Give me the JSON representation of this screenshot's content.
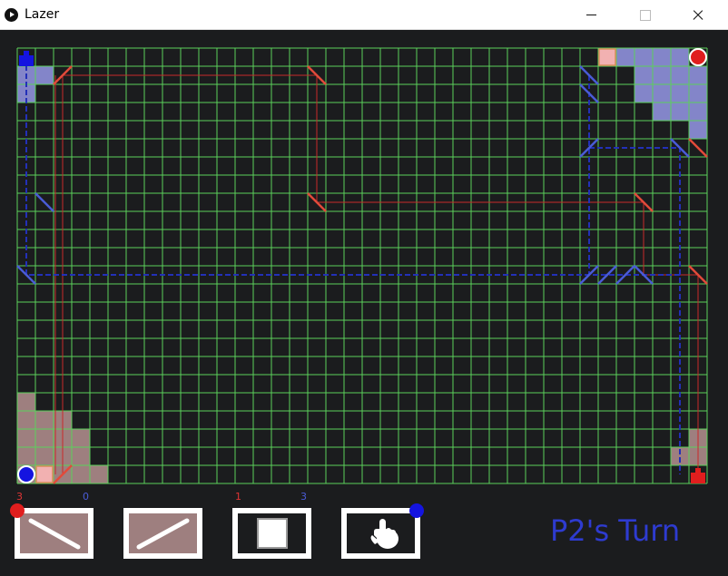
{
  "window": {
    "title": "Lazer"
  },
  "board": {
    "cols": 38,
    "rows": 24,
    "grid_color": "#5bd05b",
    "background": "#1b1c1e",
    "red_territory": [
      [
        0,
        19
      ],
      [
        0,
        20
      ],
      [
        1,
        20
      ],
      [
        2,
        20
      ],
      [
        0,
        21
      ],
      [
        1,
        21
      ],
      [
        2,
        21
      ],
      [
        3,
        21
      ],
      [
        0,
        22
      ],
      [
        1,
        22
      ],
      [
        2,
        22
      ],
      [
        3,
        22
      ],
      [
        0,
        23
      ],
      [
        2,
        23
      ],
      [
        3,
        23
      ],
      [
        4,
        23
      ],
      [
        37,
        21
      ],
      [
        36,
        22
      ],
      [
        37,
        22
      ]
    ],
    "blue_territory": [
      [
        0,
        1
      ],
      [
        1,
        1
      ],
      [
        0,
        2
      ],
      [
        33,
        0
      ],
      [
        34,
        0
      ],
      [
        35,
        0
      ],
      [
        36,
        0
      ],
      [
        34,
        1
      ],
      [
        35,
        1
      ],
      [
        36,
        1
      ],
      [
        37,
        1
      ],
      [
        34,
        2
      ],
      [
        35,
        2
      ],
      [
        36,
        2
      ],
      [
        37,
        2
      ],
      [
        35,
        3
      ],
      [
        36,
        3
      ],
      [
        37,
        3
      ],
      [
        37,
        4
      ]
    ],
    "red_blocks": [
      [
        32,
        0
      ],
      [
        1,
        23
      ]
    ],
    "red_mirrors": [
      {
        "col": 2,
        "row": 1,
        "dir": "fwd"
      },
      {
        "col": 16,
        "row": 1,
        "dir": "back"
      },
      {
        "col": 16,
        "row": 8,
        "dir": "back"
      },
      {
        "col": 34,
        "row": 8,
        "dir": "back"
      },
      {
        "col": 37,
        "row": 5,
        "dir": "back"
      },
      {
        "col": 37,
        "row": 12,
        "dir": "back"
      },
      {
        "col": 2,
        "row": 23,
        "dir": "fwd"
      }
    ],
    "blue_mirrors": [
      {
        "col": 31,
        "row": 1,
        "dir": "back"
      },
      {
        "col": 31,
        "row": 2,
        "dir": "back"
      },
      {
        "col": 31,
        "row": 5,
        "dir": "fwd"
      },
      {
        "col": 36,
        "row": 5,
        "dir": "back"
      },
      {
        "col": 1,
        "row": 8,
        "dir": "back"
      },
      {
        "col": 0,
        "row": 12,
        "dir": "back"
      },
      {
        "col": 31,
        "row": 12,
        "dir": "fwd"
      },
      {
        "col": 32,
        "row": 12,
        "dir": "fwd"
      },
      {
        "col": 33,
        "row": 12,
        "dir": "fwd"
      },
      {
        "col": 34,
        "row": 12,
        "dir": "back"
      }
    ],
    "red_laser_path": [
      [
        2.5,
        1.5
      ],
      [
        16.5,
        1.5
      ],
      [
        16.5,
        8.5
      ],
      [
        34.5,
        8.5
      ],
      [
        34.5,
        12.5
      ],
      [
        37.5,
        12.5
      ],
      [
        37.5,
        23.5
      ]
    ],
    "red_laser_left": [
      [
        2.5,
        1.5
      ],
      [
        2.5,
        23.5
      ]
    ],
    "red_laser_inner": [
      [
        2.1,
        1.5
      ],
      [
        2.1,
        23.5
      ]
    ],
    "blue_laser_path": [
      [
        0.5,
        0.5
      ],
      [
        0.5,
        12.5
      ],
      [
        34.5,
        12.5
      ],
      [
        36.5,
        12.5
      ]
    ],
    "blue_laser_right": [
      [
        31.5,
        5.5
      ],
      [
        36.5,
        5.5
      ],
      [
        36.5,
        23.5
      ]
    ],
    "blue_laser_top": [
      [
        31.5,
        1.5
      ],
      [
        31.5,
        12.5
      ]
    ],
    "red_player_pieces": [
      {
        "col": 37,
        "row": 0,
        "shape": "circle"
      },
      {
        "col": 37,
        "row": 23,
        "shape": "tank"
      }
    ],
    "blue_player_pieces": [
      {
        "col": 0,
        "row": 0,
        "shape": "tank"
      },
      {
        "col": 0,
        "row": 23,
        "shape": "circle"
      }
    ],
    "colors": {
      "red": "#e01e1e",
      "blue": "#1414e0",
      "red_territory": "#9e7f7f",
      "blue_territory": "#8385c9",
      "red_block": "#f2b1b1",
      "red_mirror": "#e24a3a",
      "blue_mirror": "#4a5bd6",
      "red_laser": "#c92a2a",
      "blue_laser": "#2330b8"
    }
  },
  "counts": {
    "red_mirror_back": "3",
    "blue_mirror_back": "0",
    "red_block": "1",
    "blue_block": "3"
  },
  "tools": [
    {
      "name": "mirror-back",
      "selected_by": "red"
    },
    {
      "name": "mirror-forward",
      "selected_by": ""
    },
    {
      "name": "block",
      "selected_by": ""
    },
    {
      "name": "pointer",
      "selected_by": "blue"
    }
  ],
  "turn": {
    "label": "P2's Turn",
    "color": "#2e3bd0"
  }
}
